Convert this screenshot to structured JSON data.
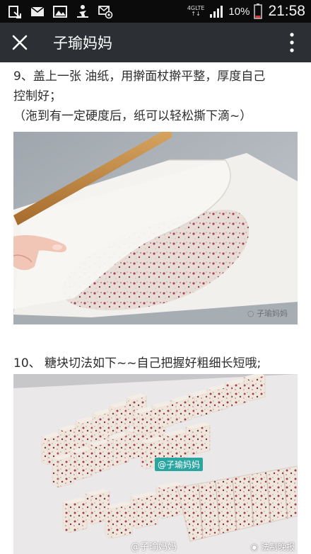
{
  "status_bar": {
    "network_top": "4GLTE",
    "network_bottom": "↑↓",
    "battery_percent": "10%",
    "time": "21:58",
    "icons": [
      "notification-icon",
      "mail-icon",
      "image-icon",
      "person-icon",
      "mail-at-icon",
      "signal-icon",
      "battery-icon"
    ]
  },
  "header": {
    "title": "子瑜妈妈",
    "close_icon": "close-icon",
    "more_icon": "more-vert-icon",
    "background": "#2c3034"
  },
  "article": {
    "step9_line1": "9、盖上一张 油纸，用擀面杖擀平整，厚度自己",
    "step9_line2": "控制好；",
    "step9_line3": "（沲到有一定硬度后，纸可以轻松撕下滴~）",
    "photo1_watermark": "子瑜妈妈",
    "step10_line1": "10、 糖块切法如下~~自己把握好粗细长短哦;",
    "photo2_tag": "@子瑜妈妈",
    "photo2_watermark": "@子瑜妈妈",
    "corner_watermark": "法制晚报"
  }
}
